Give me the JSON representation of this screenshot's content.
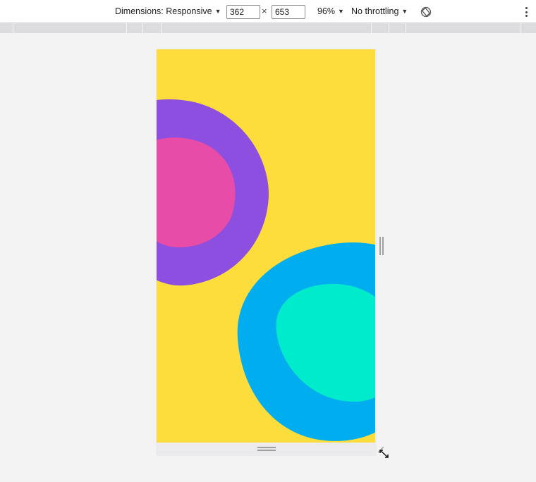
{
  "toolbar": {
    "dimensions_label": "Dimensions: Responsive",
    "width_value": "362",
    "times_symbol": "×",
    "height_value": "653",
    "zoom_label": "96%",
    "throttling_label": "No throttling",
    "caret": "▼",
    "rotate_icon": "rotate-icon",
    "more_icon": "kebab-menu-icon"
  },
  "viewport": {
    "background_color": "#fcdd3c",
    "shapes": [
      {
        "name": "purple-blob",
        "color": "#8c4fe0"
      },
      {
        "name": "pink-blob",
        "color": "#e64ca8"
      },
      {
        "name": "blue-blob",
        "color": "#00aeef"
      },
      {
        "name": "teal-blob",
        "color": "#00ebcb"
      }
    ]
  }
}
